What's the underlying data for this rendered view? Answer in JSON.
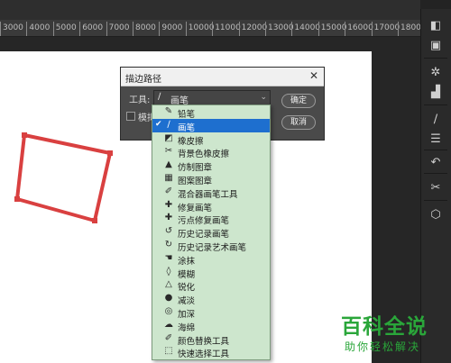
{
  "ruler": {
    "ticks": [
      "3000",
      "4000",
      "5000",
      "6000",
      "7000",
      "8000",
      "9000",
      "10000",
      "11000",
      "12000",
      "13000",
      "14000",
      "15000",
      "16000",
      "17000",
      "1800"
    ]
  },
  "dialog": {
    "title": "描边路径",
    "tool_label": "工具:",
    "selected_tool": "画笔",
    "ok_label": "确定",
    "cancel_label": "取消",
    "simulate_label": "模拟"
  },
  "menu": {
    "items": [
      {
        "label": "铅笔",
        "icon": "pencil-icon",
        "glyph": "✎",
        "selected": false
      },
      {
        "label": "画笔",
        "icon": "brush-icon",
        "glyph": "∕",
        "selected": true
      },
      {
        "label": "橡皮擦",
        "icon": "eraser-icon",
        "glyph": "◩",
        "selected": false
      },
      {
        "label": "背景色橡皮擦",
        "icon": "background-eraser-icon",
        "glyph": "✂",
        "selected": false
      },
      {
        "label": "仿制图章",
        "icon": "clone-stamp-icon",
        "glyph": "▲",
        "selected": false
      },
      {
        "label": "图案图章",
        "icon": "pattern-stamp-icon",
        "glyph": "▦",
        "selected": false
      },
      {
        "label": "混合器画笔工具",
        "icon": "mixer-brush-icon",
        "glyph": "✐",
        "selected": false
      },
      {
        "label": "修复画笔",
        "icon": "healing-brush-icon",
        "glyph": "✚",
        "selected": false
      },
      {
        "label": "污点修复画笔",
        "icon": "spot-healing-icon",
        "glyph": "✚",
        "selected": false
      },
      {
        "label": "历史记录画笔",
        "icon": "history-brush-icon",
        "glyph": "↺",
        "selected": false
      },
      {
        "label": "历史记录艺术画笔",
        "icon": "art-history-brush-icon",
        "glyph": "↻",
        "selected": false
      },
      {
        "label": "涂抹",
        "icon": "smudge-icon",
        "glyph": "☚",
        "selected": false
      },
      {
        "label": "模糊",
        "icon": "blur-icon",
        "glyph": "◊",
        "selected": false
      },
      {
        "label": "锐化",
        "icon": "sharpen-icon",
        "glyph": "△",
        "selected": false
      },
      {
        "label": "减淡",
        "icon": "dodge-icon",
        "glyph": "●",
        "selected": false
      },
      {
        "label": "加深",
        "icon": "burn-icon",
        "glyph": "◎",
        "selected": false
      },
      {
        "label": "海绵",
        "icon": "sponge-icon",
        "glyph": "☁",
        "selected": false
      },
      {
        "label": "颜色替换工具",
        "icon": "color-replace-icon",
        "glyph": "✐",
        "selected": false
      },
      {
        "label": "快速选择工具",
        "icon": "quick-select-icon",
        "glyph": "⬚",
        "selected": false
      }
    ]
  },
  "watermark": {
    "main": "百科全说",
    "sub": "助你轻松解决"
  },
  "colors": {
    "path_stroke": "#d94040",
    "menu_bg": "#cde6cd",
    "selection": "#1e6fcf"
  }
}
